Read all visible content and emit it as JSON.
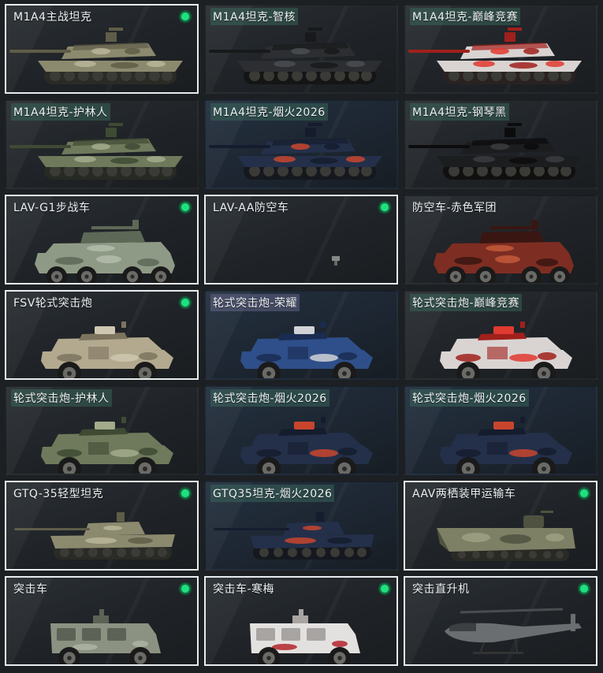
{
  "colors": {
    "owned_border": "#e9ecee",
    "check_green": "#1fe07f",
    "card_bg": "#24282c"
  },
  "items": [
    {
      "label": "M1A4主战坦克",
      "owned": true,
      "kind": "tank",
      "camo": "desert"
    },
    {
      "label": "M1A4坦克-智核",
      "owned": false,
      "kind": "tank",
      "camo": "black"
    },
    {
      "label": "M1A4坦克-巅峰竞赛",
      "owned": false,
      "kind": "tank",
      "camo": "redwhite"
    },
    {
      "label": "M1A4坦克-护林人",
      "owned": false,
      "kind": "tank",
      "camo": "forest"
    },
    {
      "label": "M1A4坦克-烟火2026",
      "owned": false,
      "kind": "tank",
      "camo": "navy"
    },
    {
      "label": "M1A4坦克-钢琴黑",
      "owned": false,
      "kind": "tank",
      "camo": "piano"
    },
    {
      "label": "LAV-G1步战车",
      "owned": true,
      "kind": "apc",
      "camo": "green"
    },
    {
      "label": "LAV-AA防空车",
      "owned": true,
      "kind": "empty",
      "camo": "none"
    },
    {
      "label": "防空车-赤色军团",
      "owned": false,
      "kind": "apc",
      "camo": "redcamo"
    },
    {
      "label": "FSV轮式突击炮",
      "owned": true,
      "kind": "fsv",
      "camo": "sand"
    },
    {
      "label": "轮式突击炮-荣耀",
      "owned": false,
      "kind": "fsv",
      "camo": "blueglory"
    },
    {
      "label": "轮式突击炮-巅峰竞赛",
      "owned": false,
      "kind": "fsv",
      "camo": "redwhite"
    },
    {
      "label": "轮式突击炮-护林人",
      "owned": false,
      "kind": "fsv",
      "camo": "forest"
    },
    {
      "label": "轮式突击炮-烟火2026",
      "owned": false,
      "kind": "fsv",
      "camo": "navy"
    },
    {
      "label": "轮式突击炮-烟火2026",
      "owned": false,
      "kind": "fsv",
      "camo": "navy"
    },
    {
      "label": "GTQ-35轻型坦克",
      "owned": true,
      "kind": "light",
      "camo": "desert"
    },
    {
      "label": "GTQ35坦克-烟火2026",
      "owned": false,
      "kind": "light",
      "camo": "navy"
    },
    {
      "label": "AAV两栖装甲运输车",
      "owned": true,
      "kind": "aav",
      "camo": "olive"
    },
    {
      "label": "突击车",
      "owned": true,
      "kind": "truck",
      "camo": "greygreen"
    },
    {
      "label": "突击车-寒梅",
      "owned": true,
      "kind": "truck",
      "camo": "whiteplum"
    },
    {
      "label": "突击直升机",
      "owned": true,
      "kind": "heli",
      "camo": "grey"
    }
  ]
}
